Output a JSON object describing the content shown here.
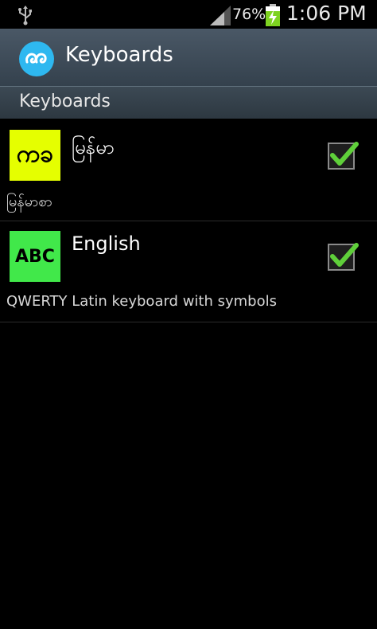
{
  "status_bar": {
    "battery_percent": "76%",
    "time": "1:06 PM",
    "icons": [
      "usb-icon",
      "signal-icon",
      "battery-charging-icon"
    ]
  },
  "title_bar": {
    "title": "Keyboards",
    "app_icon": "app-logo-icon"
  },
  "section": {
    "title": "Keyboards"
  },
  "keyboards": [
    {
      "icon_text": "ကခ",
      "title": "မြန်မာ",
      "description": "မြန်မာစာ",
      "checked": true,
      "icon_color": "#e5ff00"
    },
    {
      "icon_text": "ABC",
      "title": "English",
      "description": "QWERTY Latin keyboard with symbols",
      "checked": true,
      "icon_color": "#41e84a"
    }
  ],
  "colors": {
    "checkmark": "#5fcf3a",
    "accent": "#2eb8f0"
  }
}
